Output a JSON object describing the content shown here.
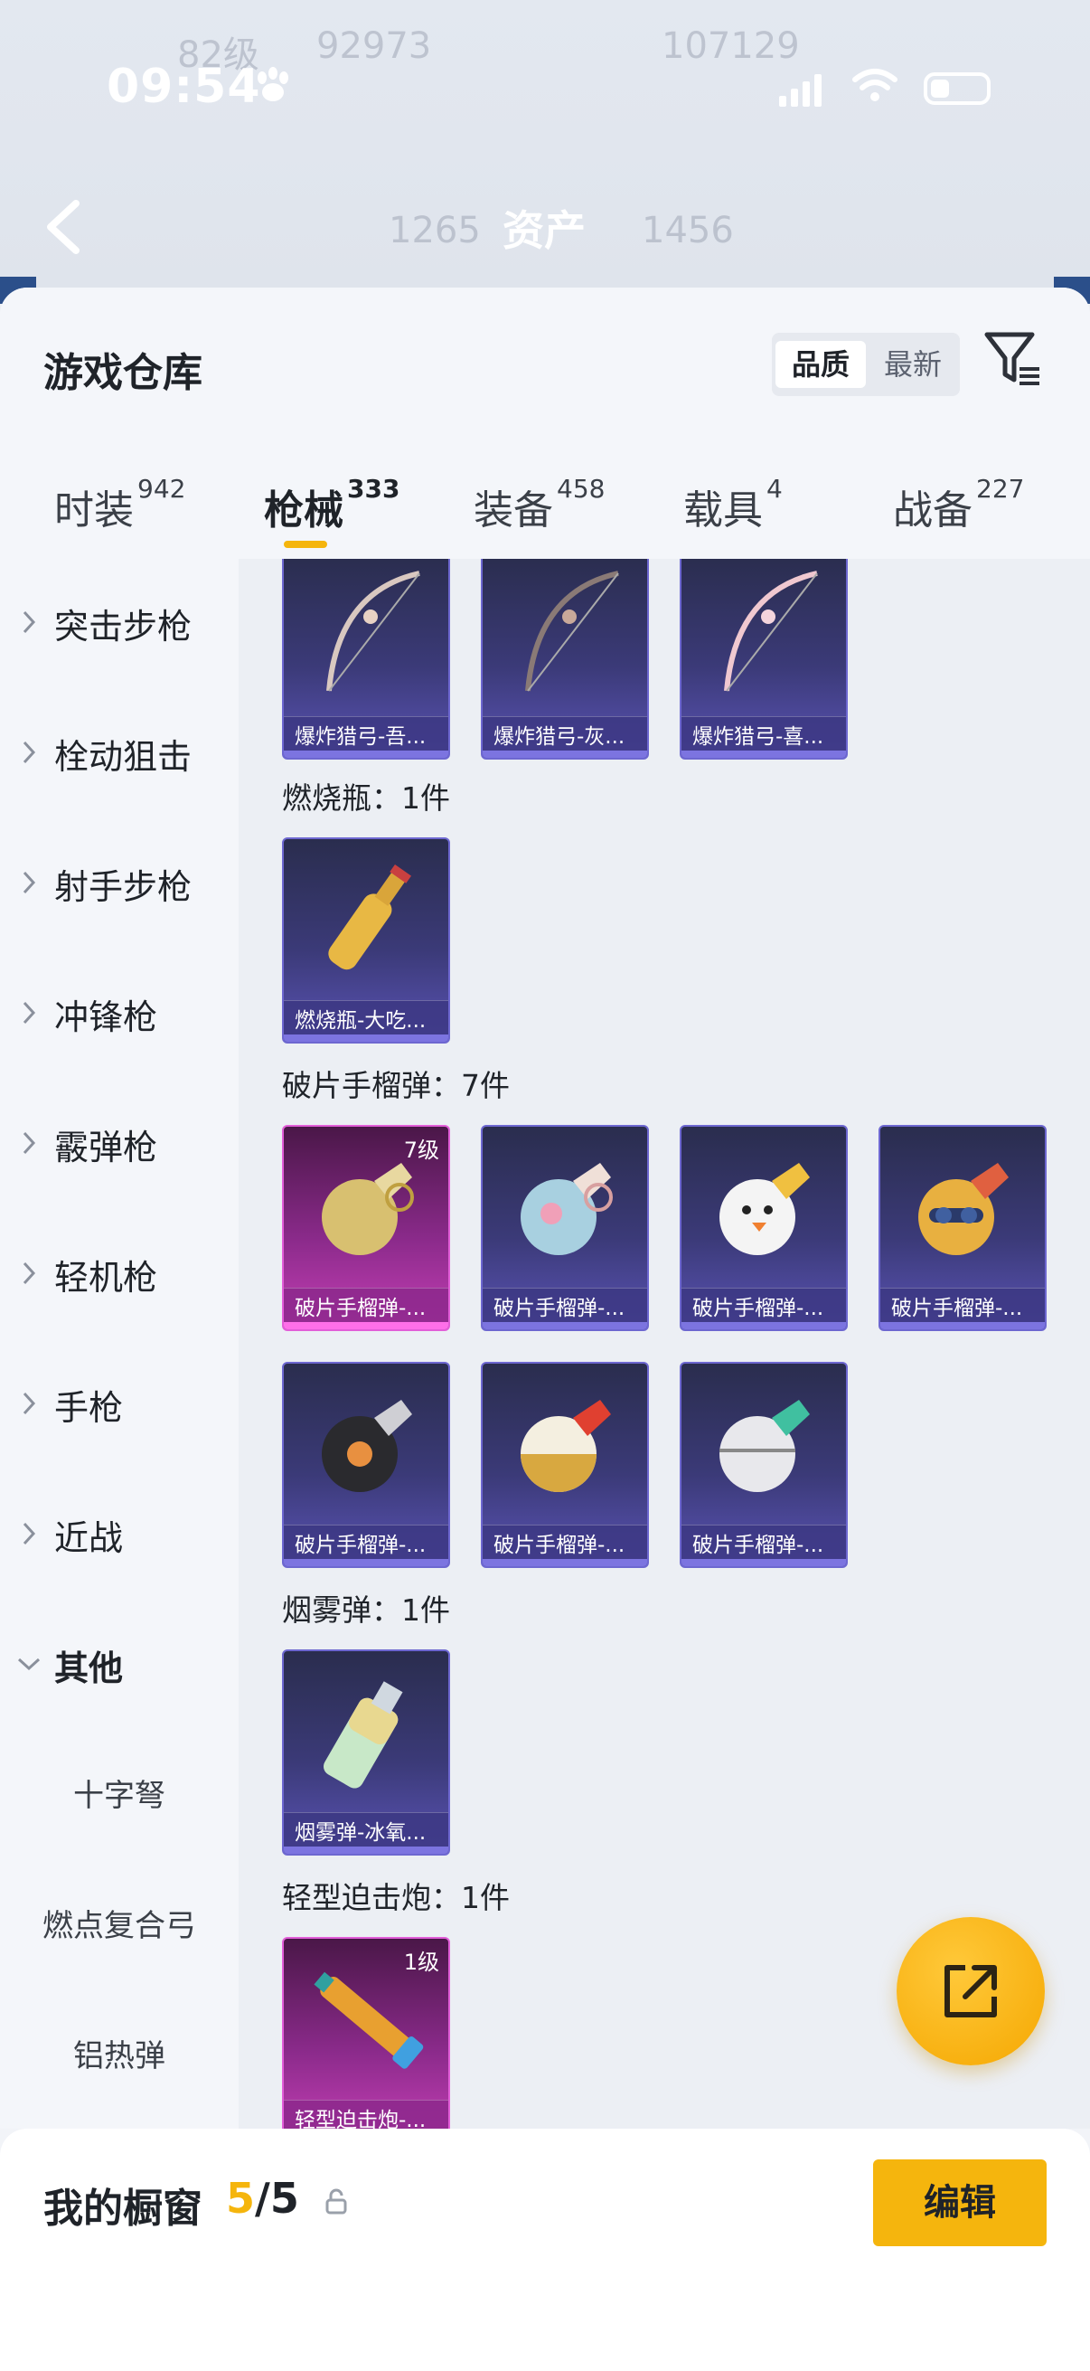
{
  "status_bar": {
    "time": "09:54"
  },
  "header": {
    "title": "资产",
    "ghost_stats": [
      "82级",
      "92973",
      "107129",
      "1265",
      "1456"
    ]
  },
  "sheet": {
    "title": "游戏仓库",
    "sort": {
      "options": [
        "品质",
        "最新"
      ],
      "selected": "品质"
    }
  },
  "tabs": [
    {
      "label": "时装",
      "count": "942",
      "active": false
    },
    {
      "label": "枪械",
      "count": "333",
      "active": true
    },
    {
      "label": "装备",
      "count": "458",
      "active": false
    },
    {
      "label": "载具",
      "count": "4",
      "active": false
    },
    {
      "label": "战备",
      "count": "227",
      "active": false
    }
  ],
  "sidebar": {
    "items": [
      {
        "label": "突击步枪",
        "expanded": false
      },
      {
        "label": "栓动狙击",
        "expanded": false
      },
      {
        "label": "射手步枪",
        "expanded": false
      },
      {
        "label": "冲锋枪",
        "expanded": false
      },
      {
        "label": "霰弹枪",
        "expanded": false
      },
      {
        "label": "轻机枪",
        "expanded": false
      },
      {
        "label": "手枪",
        "expanded": false
      },
      {
        "label": "近战",
        "expanded": false
      },
      {
        "label": "其他",
        "expanded": true
      }
    ],
    "sub_items": [
      "十字弩",
      "燃点复合弓",
      "铝热弹"
    ]
  },
  "content": {
    "top_row": [
      "爆炸猎弓-吾...",
      "爆炸猎弓-灰...",
      "爆炸猎弓-喜..."
    ],
    "sections": [
      {
        "heading": "燃烧瓶：1件",
        "items": [
          {
            "name": "燃烧瓶-大吃...",
            "level": ""
          }
        ]
      },
      {
        "heading": "破片手榴弹：7件",
        "items": [
          {
            "name": "破片手榴弹-...",
            "level": "7级"
          },
          {
            "name": "破片手榴弹-...",
            "level": ""
          },
          {
            "name": "破片手榴弹-...",
            "level": ""
          },
          {
            "name": "破片手榴弹-...",
            "level": ""
          },
          {
            "name": "破片手榴弹-...",
            "level": ""
          },
          {
            "name": "破片手榴弹-...",
            "level": ""
          },
          {
            "name": "破片手榴弹-...",
            "level": ""
          }
        ]
      },
      {
        "heading": "烟雾弹：1件",
        "items": [
          {
            "name": "烟雾弹-冰氧...",
            "level": ""
          }
        ]
      },
      {
        "heading": "轻型迫击炮：1件",
        "items": [
          {
            "name": "轻型迫击炮-...",
            "level": "1级"
          }
        ]
      }
    ]
  },
  "bottom": {
    "label": "我的橱窗",
    "count_used": "5",
    "count_sep": "/",
    "count_total": "5",
    "edit_label": "编辑"
  },
  "colors": {
    "accent": "#f5b50d",
    "card_blue": "#3b3a78",
    "card_pink": "#8a2a8a"
  }
}
